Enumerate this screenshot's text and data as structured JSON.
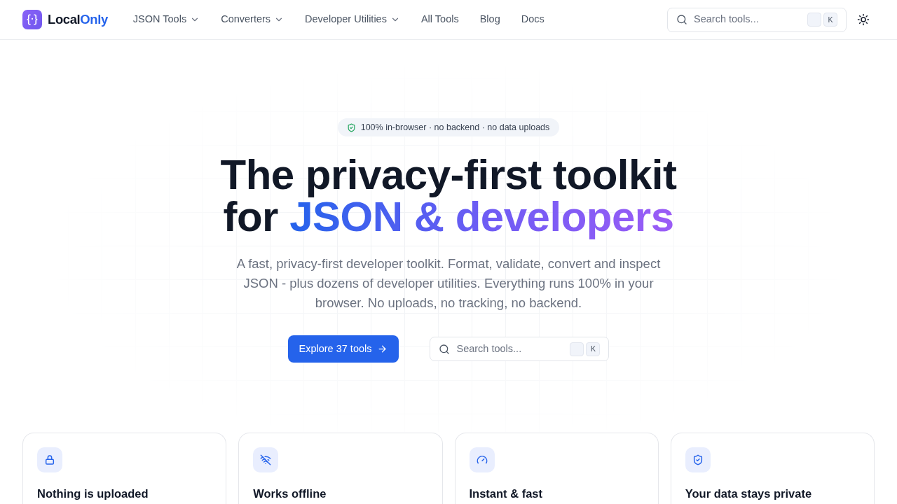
{
  "navbar": {
    "logo": {
      "text": "Local",
      "accent": "Only"
    },
    "menu": [
      {
        "label": "JSON Tools",
        "dropdown": true
      },
      {
        "label": "Converters",
        "dropdown": true
      },
      {
        "label": "Developer Utilities",
        "dropdown": true
      },
      {
        "label": "All Tools",
        "dropdown": false
      },
      {
        "label": "Blog",
        "dropdown": false
      },
      {
        "label": "Docs",
        "dropdown": false
      }
    ],
    "search": {
      "placeholder": "Search tools...",
      "shortcut_key": "K"
    }
  },
  "hero": {
    "badge": "100% in-browser · no backend · no data uploads",
    "heading": "The privacy-first toolkit for",
    "heading_highlight": "JSON & developers",
    "description": "A fast, privacy-first developer toolkit. Format, validate, convert and inspect JSON - plus dozens of developer utilities. Everything runs 100% in your browser. No uploads, no tracking, no backend.",
    "primary_button": "Explore 37 tools",
    "search": {
      "placeholder": "Search tools...",
      "shortcut_key": "K"
    }
  },
  "features": [
    {
      "title": "Nothing is uploaded"
    },
    {
      "title": "Works offline"
    },
    {
      "title": "Instant & fast"
    },
    {
      "title": "Your data stays private"
    }
  ]
}
